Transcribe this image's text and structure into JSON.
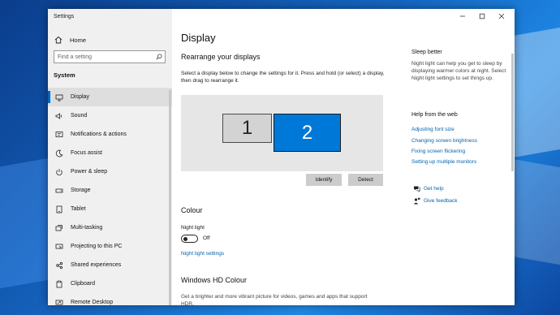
{
  "window": {
    "title": "Settings"
  },
  "sidebar": {
    "home_label": "Home",
    "search": {
      "placeholder": "Find a setting",
      "value": ""
    },
    "section_title": "System",
    "items": [
      {
        "label": "Display",
        "icon": "display-icon",
        "active": true
      },
      {
        "label": "Sound",
        "icon": "speaker-icon"
      },
      {
        "label": "Notifications & actions",
        "icon": "notifications-icon"
      },
      {
        "label": "Focus assist",
        "icon": "moon-icon"
      },
      {
        "label": "Power & sleep",
        "icon": "power-icon"
      },
      {
        "label": "Storage",
        "icon": "storage-icon"
      },
      {
        "label": "Tablet",
        "icon": "tablet-icon"
      },
      {
        "label": "Multi-tasking",
        "icon": "multitasking-icon"
      },
      {
        "label": "Projecting to this PC",
        "icon": "projector-icon"
      },
      {
        "label": "Shared experiences",
        "icon": "shared-icon"
      },
      {
        "label": "Clipboard",
        "icon": "clipboard-icon"
      },
      {
        "label": "Remote Desktop",
        "icon": "remote-desktop-icon"
      }
    ]
  },
  "main": {
    "page_title": "Display",
    "rearrange": {
      "heading": "Rearrange your displays",
      "description": "Select a display below to change the settings for it. Press and hold (or select) a display, then drag to rearrange it.",
      "monitors": [
        {
          "number": "1",
          "selected": false
        },
        {
          "number": "2",
          "selected": true
        }
      ],
      "identify_label": "Identify",
      "detect_label": "Detect"
    },
    "colour": {
      "heading": "Colour",
      "night_light_label": "Night light",
      "toggle_state": "Off",
      "settings_link": "Night light settings"
    },
    "hd_colour": {
      "heading": "Windows HD Colour",
      "description": "Get a brighter and more vibrant picture for videos, games and apps that support HDR."
    }
  },
  "right_panel": {
    "sleep_better": {
      "heading": "Sleep better",
      "description": "Night light can help you get to sleep by displaying warmer colors at night. Select Night light settings to set things up."
    },
    "help": {
      "heading": "Help from the web",
      "links": [
        "Adjusting font size",
        "Changing screen brightness",
        "Fixing screen flickering",
        "Setting up multiple monitors"
      ]
    },
    "get_help": "Get help",
    "give_feedback": "Give feedback"
  },
  "colors": {
    "accent": "#0078d7",
    "link": "#0063b1",
    "sidebar_bg": "#f0f0f0"
  }
}
